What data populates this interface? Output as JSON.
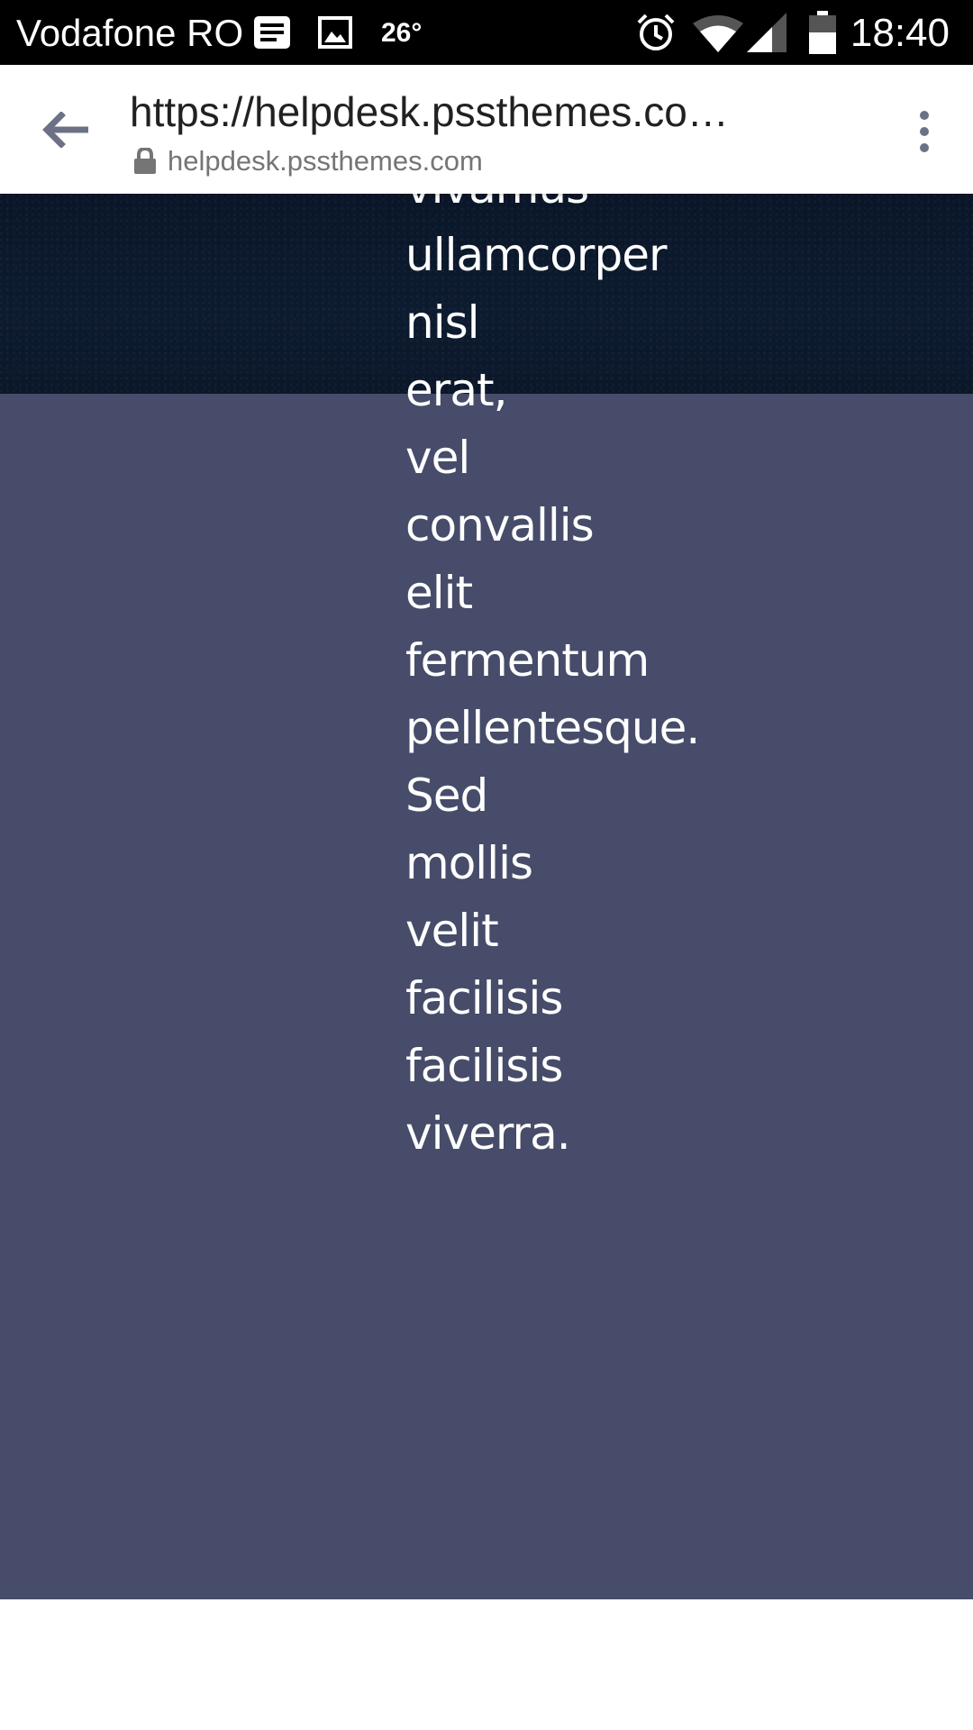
{
  "status_bar": {
    "carrier": "Vodafone RO",
    "temperature": "26°",
    "time": "18:40",
    "icons": [
      "notification-card-icon",
      "gallery-icon",
      "alarm-icon",
      "wifi-icon",
      "signal-icon",
      "battery-icon"
    ]
  },
  "browser": {
    "page_title": "https://helpdesk.pssthemes.co…",
    "origin": "helpdesk.pssthemes.com",
    "icons": [
      "back-arrow-icon",
      "lock-icon",
      "more-vert-icon"
    ]
  },
  "content": {
    "words": [
      {
        "text": "vivamus",
        "align": "left"
      },
      {
        "text": "ullamcorper",
        "align": "left"
      },
      {
        "text": "nisl",
        "align": "right"
      },
      {
        "text": "erat,",
        "align": "right"
      },
      {
        "text": "vel",
        "align": "right"
      },
      {
        "text": "convallis",
        "align": "left"
      },
      {
        "text": "elit",
        "align": "right"
      },
      {
        "text": "fermentum",
        "align": "left"
      },
      {
        "text": "pellentesque.",
        "align": "left"
      },
      {
        "text": "Sed",
        "align": "right"
      },
      {
        "text": "mollis",
        "align": "right"
      },
      {
        "text": "velit",
        "align": "right"
      },
      {
        "text": "facilisis",
        "align": "right"
      },
      {
        "text": "facilisis",
        "align": "right"
      },
      {
        "text": "viverra.",
        "align": "right"
      }
    ]
  },
  "colors": {
    "hero_background": "#0b182b",
    "content_background": "#464c69",
    "text": "#ffffff"
  }
}
